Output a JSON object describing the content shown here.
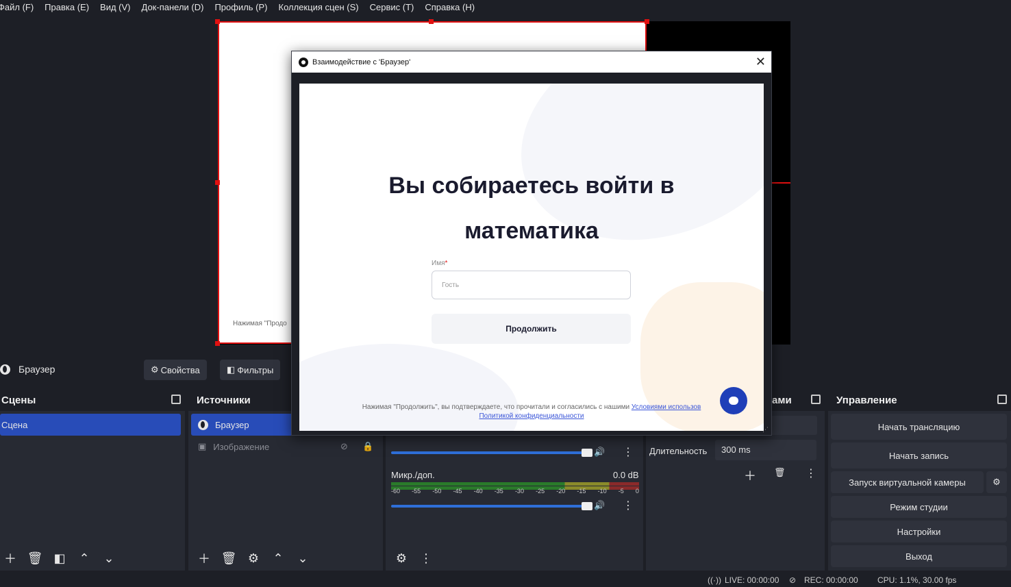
{
  "menu": [
    "Файл (F)",
    "Правка (E)",
    "Вид (V)",
    "Док-панели (D)",
    "Профиль (P)",
    "Коллекция сцен (S)",
    "Сервис (T)",
    "Справка (H)"
  ],
  "preview": {
    "behind_text": "Нажимая \"Продо"
  },
  "dialog": {
    "title": "Взаимодействие с 'Браузер'",
    "close": "✕",
    "page": {
      "title_line1": "Вы собираетесь войти в",
      "title_line2": "математика",
      "name_label": "Имя",
      "required_mark": "*",
      "name_placeholder": "Гость",
      "continue_label": "Продолжить",
      "legal_prefix": "Нажимая \"Продолжить\", вы подтверждаете, что прочитали и согласились с нашими ",
      "legal_link1": "Условиями использов",
      "legal_link2": "Политикой конфиденциальности"
    }
  },
  "source_toolbar": {
    "source_name": "Браузер",
    "properties": "Свойства",
    "filters": "Фильтры"
  },
  "scenes": {
    "header": "Сцены",
    "items": [
      "Сцена"
    ]
  },
  "sources": {
    "header": "Источники",
    "items": [
      "Браузер",
      "Изображение"
    ]
  },
  "mixer": {
    "channel2_name": "Микр./доп.",
    "channel2_db": "0.0 dB",
    "scale": [
      "-60",
      "-55",
      "-50",
      "-45",
      "-40",
      "-35",
      "-30",
      "-25",
      "-20",
      "-15",
      "-10",
      "-5",
      "0"
    ]
  },
  "transitions": {
    "header_tail": "ами",
    "duration_label": "Длительность",
    "duration_value": "300 ms"
  },
  "controls": {
    "header": "Управление",
    "buttons": [
      "Начать трансляцию",
      "Начать запись",
      "Запуск виртуальной камеры",
      "Режим студии",
      "Настройки",
      "Выход"
    ]
  },
  "status": {
    "live": "LIVE: 00:00:00",
    "rec": "REC: 00:00:00",
    "cpu": "CPU: 1.1%, 30.00 fps"
  },
  "colors": {
    "accent": "#284cb8",
    "selection_red": "#e01010",
    "fab": "#1f3fb8"
  }
}
